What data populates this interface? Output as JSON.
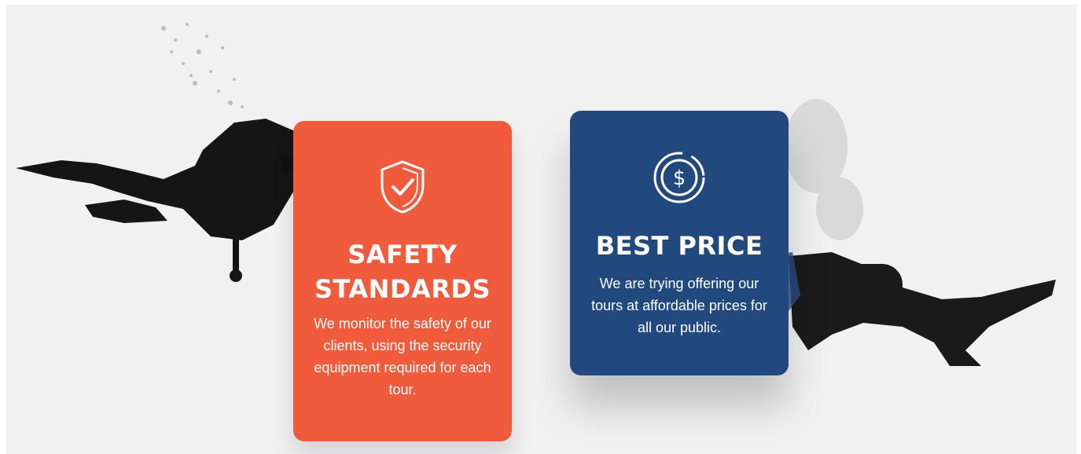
{
  "cards": [
    {
      "id": "safety",
      "title_line1": "SAFETY",
      "title_line2": "STANDARDS",
      "text": "We monitor the safety of our clients, using the security equipment required for each tour.",
      "icon": "shield-check-icon",
      "color": "#ef5b3b"
    },
    {
      "id": "price",
      "title_line1": "BEST PRICE",
      "text": "We are trying  offering our tours at affordable prices for all our public.",
      "icon": "dollar-coin-icon",
      "color": "#21497d"
    }
  ]
}
